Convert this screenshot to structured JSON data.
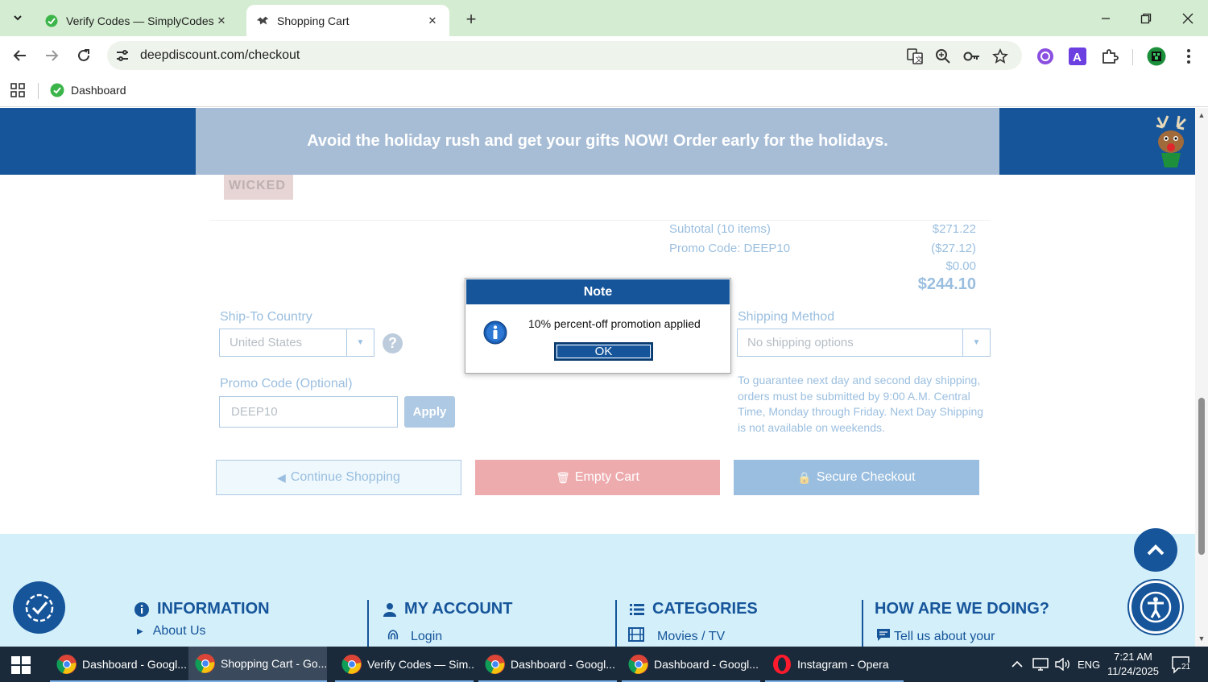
{
  "browser": {
    "tabs": [
      {
        "title": "Verify Codes — SimplyCodes",
        "active": false
      },
      {
        "title": "Shopping Cart",
        "active": true
      }
    ],
    "url": "deepdiscount.com/checkout",
    "bookmarks": [
      {
        "label": "Dashboard"
      }
    ]
  },
  "banner": {
    "text": "Avoid the holiday rush and get your gifts NOW! Order early for the holidays."
  },
  "cart": {
    "product_thumb_text": "WICKED",
    "summary": {
      "subtotal_label": "Subtotal (10 items)",
      "subtotal_value": "$271.22",
      "promo_label": "Promo Code: DEEP10",
      "promo_value": "($27.12)",
      "shipping_value": "$0.00",
      "total_value": "$244.10"
    },
    "ship_to": {
      "label": "Ship-To Country",
      "selected": "United States"
    },
    "promo": {
      "label": "Promo Code (Optional)",
      "value": "DEEP10",
      "apply_label": "Apply"
    },
    "shipping_method": {
      "label": "Shipping Method",
      "selected": "No shipping options",
      "note": "To guarantee next day and second day shipping, orders must be submitted by 9:00 A.M. Central Time, Monday through Friday. Next Day Shipping is not available on weekends."
    },
    "buttons": {
      "continue": "Continue Shopping",
      "empty": "Empty Cart",
      "checkout": "Secure Checkout"
    }
  },
  "modal": {
    "title": "Note",
    "message": "10% percent-off promotion applied",
    "ok_label": "OK"
  },
  "footer": {
    "columns": [
      {
        "heading": "INFORMATION",
        "link": "About Us"
      },
      {
        "heading": "MY ACCOUNT",
        "link": "Login"
      },
      {
        "heading": "CATEGORIES",
        "link": "Movies / TV"
      },
      {
        "heading": "HOW ARE WE DOING?",
        "link": "Tell us about your"
      }
    ]
  },
  "taskbar": {
    "items": [
      {
        "label": "Dashboard - Googl...",
        "active": false
      },
      {
        "label": "Shopping Cart - Go...",
        "active": true
      },
      {
        "label": "Verify Codes — Sim...",
        "active": false
      },
      {
        "label": "Dashboard - Googl...",
        "active": false
      },
      {
        "label": "Dashboard - Googl...",
        "active": false
      },
      {
        "label": "Instagram - Opera",
        "active": false
      }
    ],
    "language": "ENG",
    "time": "7:21 AM",
    "date": "11/24/2025",
    "notification_count": "21"
  },
  "colors": {
    "brand_blue": "#16559a",
    "link_blue": "#1e6fb8",
    "tab_bar_green": "#d4ecd1",
    "empty_cart_red": "#d9444a",
    "footer_bg": "#d3effa"
  }
}
